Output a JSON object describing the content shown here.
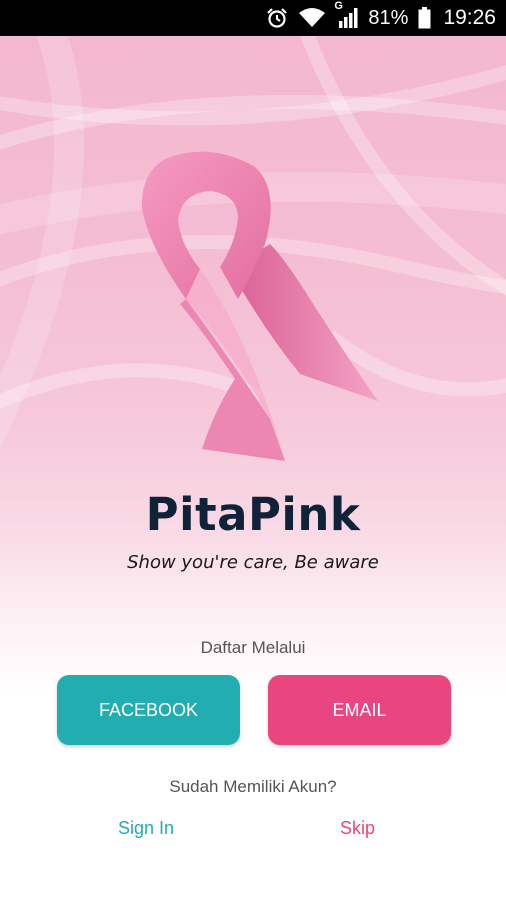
{
  "status_bar": {
    "network_label": "G",
    "battery": "81%",
    "time": "19:26",
    "icons": [
      "alarm-icon",
      "wifi-icon",
      "signal-icon",
      "battery-icon"
    ]
  },
  "app": {
    "logo": "pink-ribbon-logo",
    "title": "PitaPink",
    "tagline": "Show you're care, Be aware"
  },
  "register": {
    "label": "Daftar Melalui",
    "facebook_button": "FACEBOOK",
    "email_button": "EMAIL"
  },
  "account": {
    "question": "Sudah Memiliki Akun?",
    "sign_in": "Sign In",
    "skip": "Skip"
  },
  "colors": {
    "teal": "#22adb1",
    "pink": "#e9467f",
    "title": "#0f2238"
  }
}
